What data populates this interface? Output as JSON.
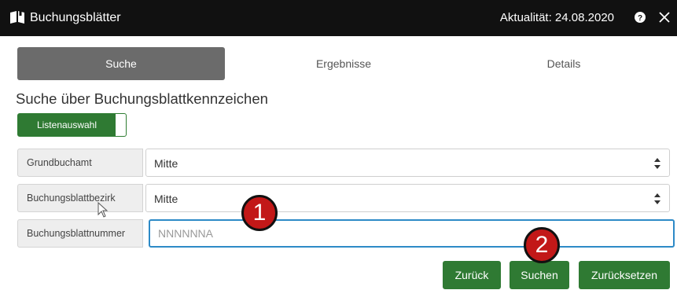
{
  "window": {
    "title": "Buchungsblätter",
    "date_label": "Aktualität: 24.08.2020",
    "icons": {
      "app": "book-icon",
      "help": "help-icon",
      "close": "close-icon"
    }
  },
  "tabs": [
    {
      "label": "Suche",
      "active": true
    },
    {
      "label": "Ergebnisse",
      "active": false
    },
    {
      "label": "Details",
      "active": false
    }
  ],
  "section_title": "Suche über Buchungsblattkennzeichen",
  "toggle": {
    "label": "Listenauswahl",
    "state": "on"
  },
  "form": {
    "grundbuchamt": {
      "label": "Grundbuchamt",
      "value": "Mitte"
    },
    "bezirk": {
      "label": "Buchungsblattbezirk",
      "value": "Mitte"
    },
    "nummer": {
      "label": "Buchungsblattnummer",
      "value": "",
      "placeholder": "NNNNNNA"
    }
  },
  "buttons": {
    "back": "Zurück",
    "search": "Suchen",
    "reset": "Zurücksetzen"
  },
  "callouts": [
    "1",
    "2"
  ],
  "colors": {
    "accent": "#2f7a33",
    "focus": "#2d8ac7",
    "callout": "#c21818",
    "titlebar": "#111111"
  }
}
